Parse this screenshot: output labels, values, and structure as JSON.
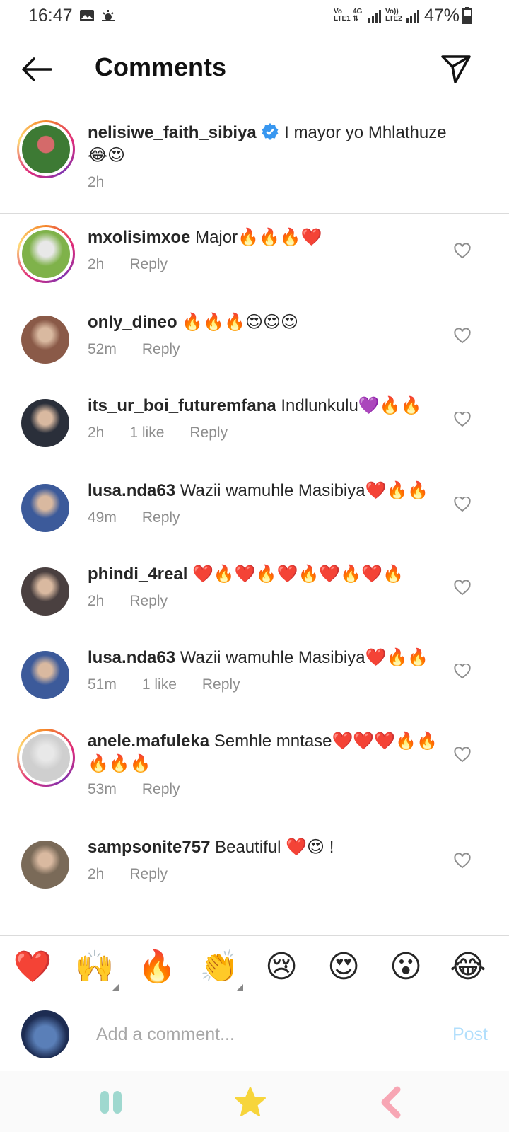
{
  "status_bar": {
    "time": "16:47",
    "net1_top": "Vo",
    "net1_bottom": "LTE1",
    "net2_top": "4G",
    "net3_top": "Vo))",
    "net3_bottom": "LTE2",
    "battery": "47%"
  },
  "header": {
    "title": "Comments"
  },
  "caption": {
    "username": "nelisiwe_faith_sibiya",
    "text": "I mayor yo Mhlathuze",
    "emojis": "😂😍",
    "time": "2h",
    "verified": true
  },
  "reply_label": "Reply",
  "comments": [
    {
      "username": "mxolisimxoe",
      "text": "Major🔥🔥🔥❤️",
      "time": "2h",
      "likes": "",
      "ring": true,
      "avatar_color": "#7fb24a"
    },
    {
      "username": "only_dineo",
      "text": "🔥🔥🔥😍😍😍",
      "time": "52m",
      "likes": "",
      "ring": false,
      "avatar_color": "#8a5a48"
    },
    {
      "username": "its_ur_boi_futuremfana",
      "text": "Indlunkulu💜🔥🔥",
      "time": "2h",
      "likes": "1 like",
      "ring": false,
      "avatar_color": "#2a2f3a"
    },
    {
      "username": "lusa.nda63",
      "text": "Wazii wamuhle Masibiya❤️🔥🔥",
      "time": "49m",
      "likes": "",
      "ring": false,
      "avatar_color": "#3c5a9a"
    },
    {
      "username": "phindi_4real",
      "text": "❤️🔥❤️🔥❤️🔥❤️🔥❤️🔥",
      "time": "2h",
      "likes": "",
      "ring": false,
      "avatar_color": "#4a4040"
    },
    {
      "username": "lusa.nda63",
      "text": "Wazii wamuhle Masibiya❤️🔥🔥",
      "time": "51m",
      "likes": "1 like",
      "ring": false,
      "avatar_color": "#3c5a9a"
    },
    {
      "username": "anele.mafuleka",
      "text": "Semhle mntase❤️❤️❤️🔥🔥🔥🔥🔥",
      "time": "53m",
      "likes": "",
      "ring": true,
      "avatar_color": "#cfcfcf"
    },
    {
      "username": "sampsonite757",
      "text": "Beautiful ❤️😍 !",
      "time": "2h",
      "likes": "",
      "ring": false,
      "avatar_color": "#7a6a58"
    }
  ],
  "quick_emojis": [
    "❤️",
    "🙌",
    "🔥",
    "👏",
    "😢",
    "😍",
    "😮",
    "😂"
  ],
  "compose": {
    "placeholder": "Add a comment...",
    "post_label": "Post"
  },
  "colors": {
    "accent": "#0095f6",
    "post_disabled": "#b2dffc",
    "meta": "#8e8e8e",
    "heart_red": "#ed4956",
    "nav_teal": "#9fd8cf",
    "nav_yellow": "#f7d53c",
    "nav_pink": "#f7a6b4"
  },
  "icons": [
    "back-arrow-icon",
    "send-icon",
    "verified-badge-icon",
    "heart-outline-icon",
    "recent-apps-icon",
    "home-icon",
    "back-icon"
  ]
}
